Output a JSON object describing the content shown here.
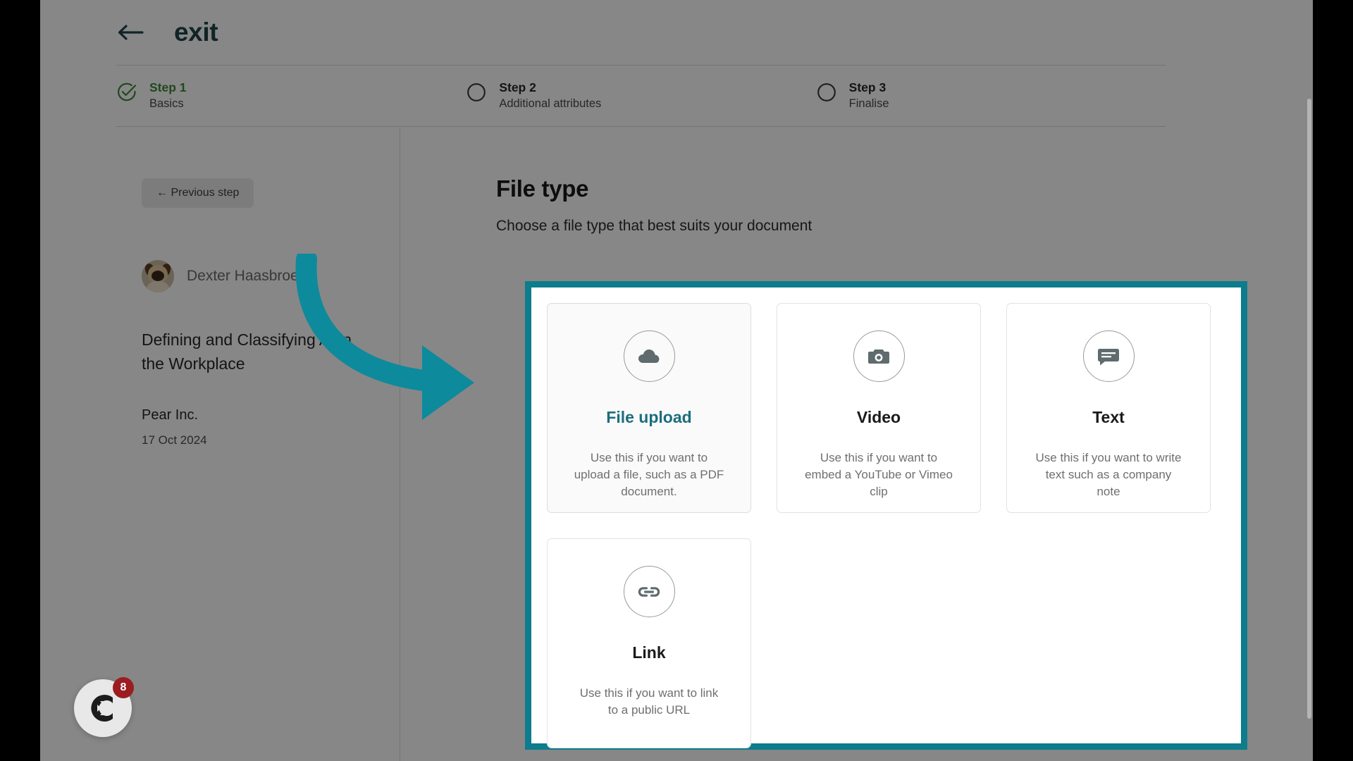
{
  "topbar": {
    "back_icon": "arrow-left-icon",
    "exit_label": "exit"
  },
  "stepper": {
    "steps": [
      {
        "title": "Step 1",
        "subtitle": "Basics",
        "state": "done",
        "icon": "check-circle-icon"
      },
      {
        "title": "Step 2",
        "subtitle": "Additional attributes",
        "state": "todo",
        "icon": "circle-icon"
      },
      {
        "title": "Step 3",
        "subtitle": "Finalise",
        "state": "todo",
        "icon": "circle-icon"
      }
    ]
  },
  "sidebar": {
    "previous_step_label": "← Previous step",
    "author_name": "Dexter Haasbroek",
    "avatar_icon": "avatar",
    "document_title": "Defining and Classifying AI in the Workplace",
    "organisation": "Pear Inc.",
    "date": "17 Oct 2024"
  },
  "main": {
    "heading": "File type",
    "subheading": "Choose a file type that best suits your document",
    "cards": [
      {
        "icon": "cloud-upload-icon",
        "title": "File upload",
        "description": "Use this if you want to upload a file, such as a PDF document.",
        "selected": true
      },
      {
        "icon": "camera-icon",
        "title": "Video",
        "description": "Use this if you want to embed a YouTube or Vimeo clip",
        "selected": false
      },
      {
        "icon": "message-icon",
        "title": "Text",
        "description": "Use this if you want to write text such as a company note",
        "selected": false
      },
      {
        "icon": "link-icon",
        "title": "Link",
        "description": "Use this if you want to link to a public URL",
        "selected": false
      }
    ]
  },
  "chat_widget": {
    "icon": "chat-launcher-icon",
    "badge_count": "8"
  },
  "colors": {
    "brand_teal": "#1f4448",
    "highlight_teal": "#0d7c8c",
    "step_done_green": "#3d8b37",
    "accent_link_teal": "#1c6d7d",
    "badge_red": "#9b1c21"
  }
}
